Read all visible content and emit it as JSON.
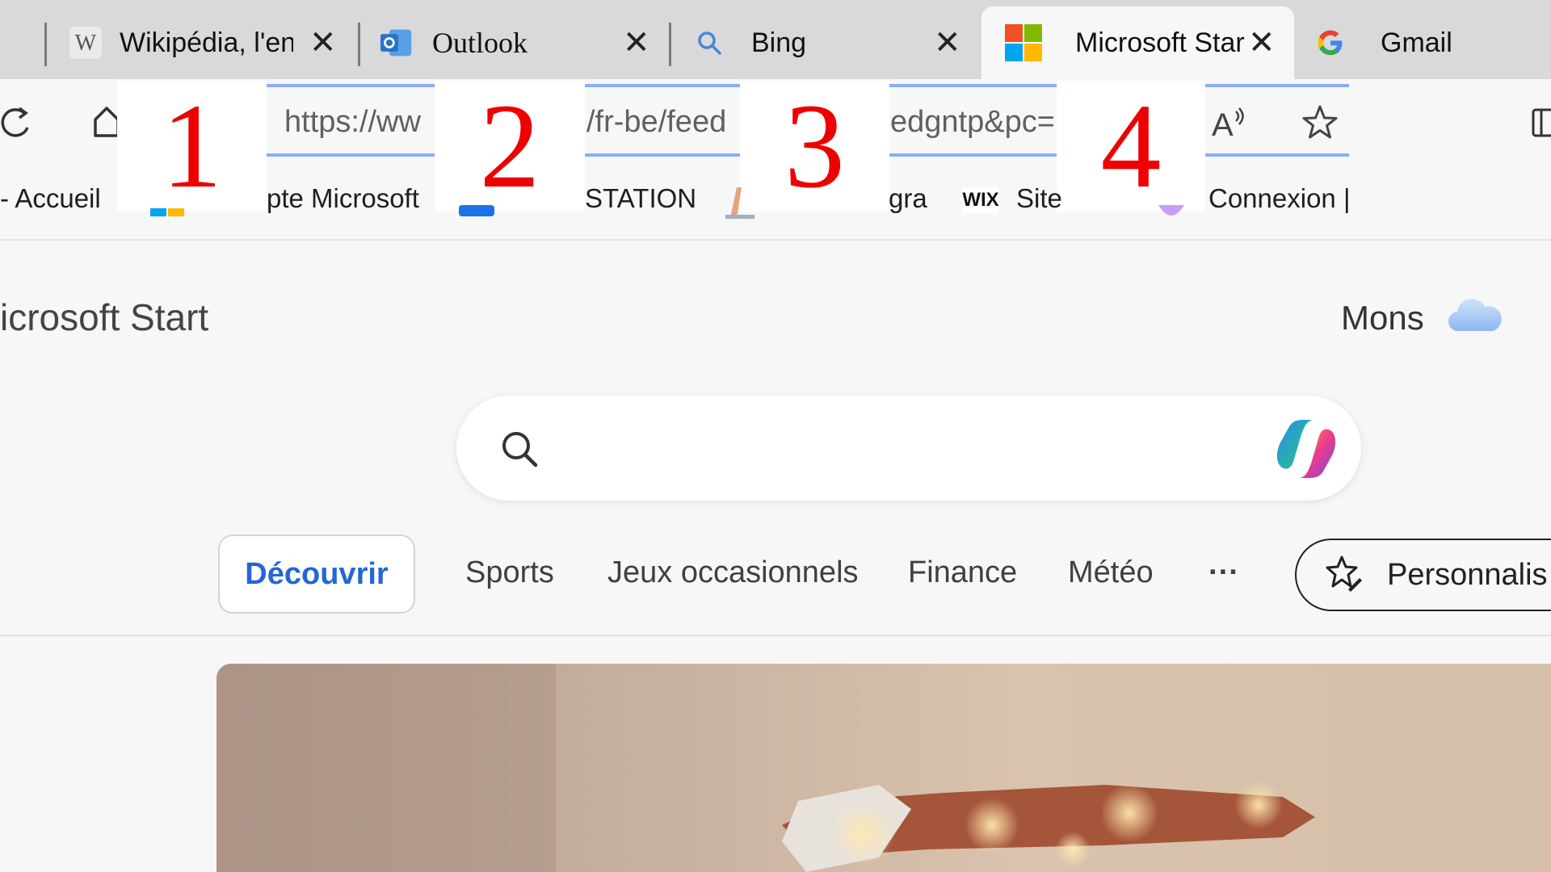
{
  "tabs": [
    {
      "title": "Wikipédia, l'en",
      "icon": "wikipedia-icon"
    },
    {
      "title": "Outlook",
      "icon": "outlook-icon"
    },
    {
      "title": "Bing",
      "icon": "search-icon"
    },
    {
      "title": "Microsoft Star",
      "icon": "microsoft-logo-icon",
      "active": true
    },
    {
      "title": "Gmail",
      "icon": "google-icon"
    }
  ],
  "address_bar": {
    "segments": [
      "https://ww",
      "/fr-be/feed",
      "edgntp&pc="
    ]
  },
  "overlay_numbers": [
    "1",
    "2",
    "3",
    "4"
  ],
  "bookmarks": [
    {
      "label": "- Accueil"
    },
    {
      "label": "pte Microsoft"
    },
    {
      "label": "STATION"
    },
    {
      "label": "gra"
    },
    {
      "label": "Site",
      "icon_text": "WIX"
    },
    {
      "label": "Connexion |"
    }
  ],
  "page": {
    "brand": "icrosoft Start",
    "location": "Mons",
    "nav": {
      "discover": "Découvrir",
      "sports": "Sports",
      "games": "Jeux occasionnels",
      "finance": "Finance",
      "weather": "Météo",
      "more": "···",
      "personalize": "Personnalis"
    }
  },
  "colors": {
    "accent": "#2566d6",
    "overlay_number": "#ee0000",
    "tabstrip": "#d9d9d9"
  }
}
